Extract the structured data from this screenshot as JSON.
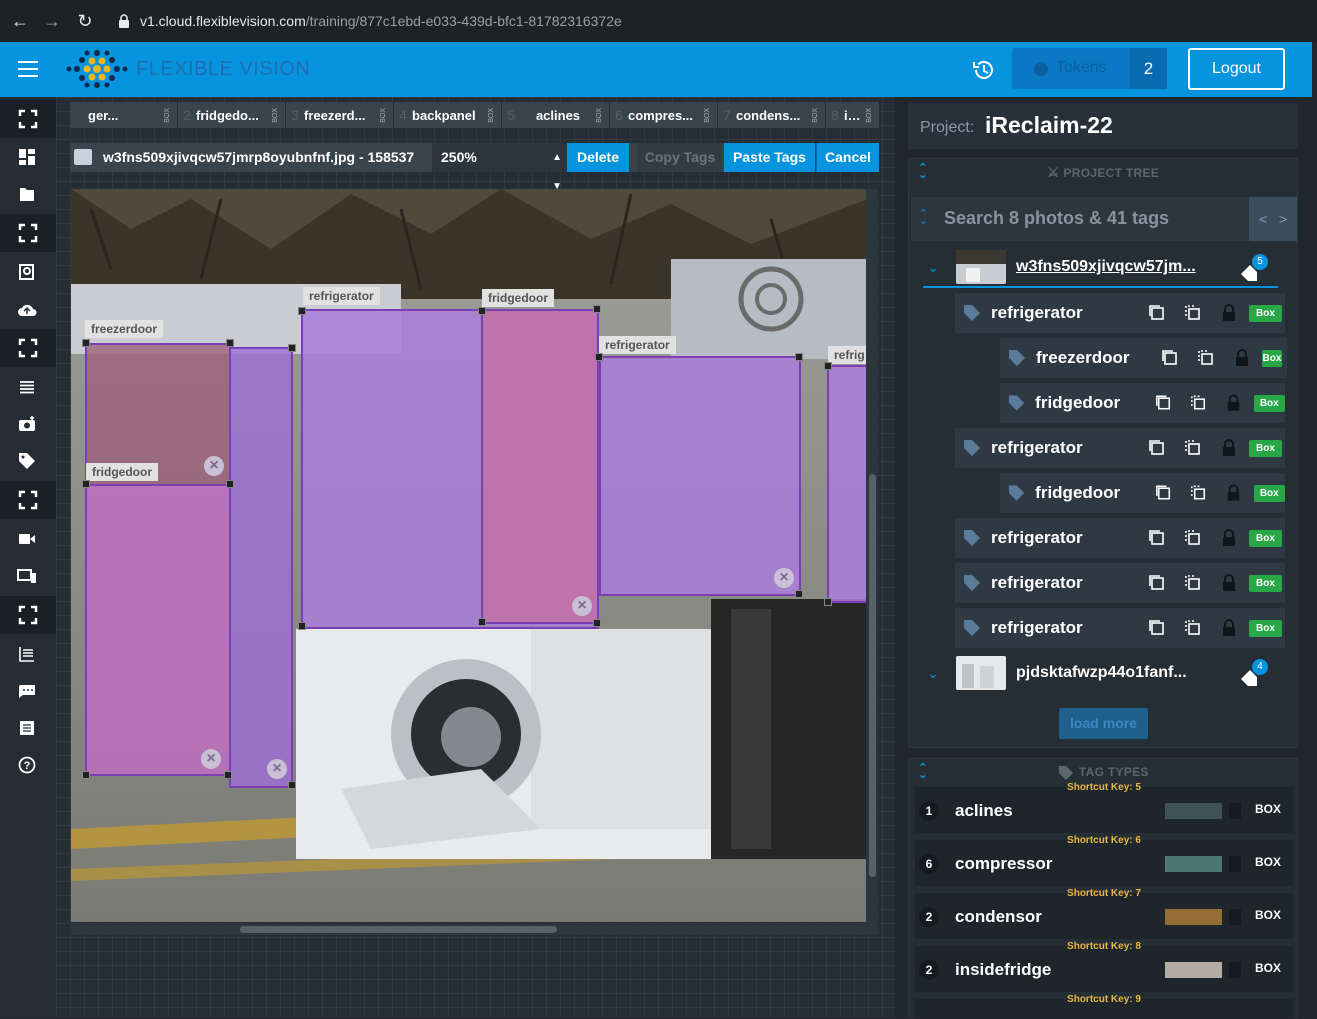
{
  "browser": {
    "url_host": "v1.cloud.flexiblevision.com",
    "url_path": "/training/877c1ebd-e033-439d-bfc1-81782316372e"
  },
  "header": {
    "logo_text": "FLEXIBLE VISION",
    "tokens_label": "Tokens",
    "tokens_count": "2",
    "logout_label": "Logout"
  },
  "tagbar": [
    {
      "num": "",
      "label": "ger...",
      "type": "BOX"
    },
    {
      "num": "2",
      "label": "fridgedo...",
      "type": "BOX"
    },
    {
      "num": "3",
      "label": "freezerd...",
      "type": "BOX"
    },
    {
      "num": "4",
      "label": "backpanel",
      "type": "BOX"
    },
    {
      "num": "5",
      "label": "aclines",
      "type": "BOX"
    },
    {
      "num": "6",
      "label": "compres...",
      "type": "BOX"
    },
    {
      "num": "7",
      "label": "condens...",
      "type": "BOX"
    },
    {
      "num": "8",
      "label": "insidefri...",
      "type": "BOX"
    }
  ],
  "toolbar": {
    "filename": "w3fns509xjivqcw57jmrp8oyubnfnf.jpg - 158537",
    "zoom": "250%",
    "delete": "Delete",
    "copy_tags": "Copy Tags",
    "paste_tags": "Paste Tags",
    "cancel": "Cancel"
  },
  "annotations": [
    {
      "label": "freezerdoor"
    },
    {
      "label": "fridgedoor"
    },
    {
      "label": "refrigerator"
    },
    {
      "label": "fridgedoor"
    },
    {
      "label": "refrigerator"
    },
    {
      "label": "refrig"
    }
  ],
  "project": {
    "key": "Project:",
    "name": "iReclaim-22"
  },
  "project_tree": {
    "title": "PROJECT TREE",
    "search_placeholder": "Search 8 photos & 41 tags",
    "prev": "<",
    "next": ">",
    "photos": [
      {
        "name": "w3fns509xjivqcw57jm...",
        "tag_count": "5"
      },
      {
        "name": "pjdsktafwzp44o1fanf...",
        "tag_count": "4"
      }
    ],
    "tags": [
      {
        "label": "refrigerator",
        "type": "Box"
      },
      {
        "label": "freezerdoor",
        "type": "Box"
      },
      {
        "label": "fridgedoor",
        "type": "Box"
      },
      {
        "label": "refrigerator",
        "type": "Box"
      },
      {
        "label": "fridgedoor",
        "type": "Box"
      },
      {
        "label": "refrigerator",
        "type": "Box"
      },
      {
        "label": "refrigerator",
        "type": "Box"
      },
      {
        "label": "refrigerator",
        "type": "Box"
      }
    ],
    "load_more": "load more"
  },
  "tag_types": {
    "title": "TAG TYPES",
    "items": [
      {
        "shortcut": "Shortcut Key: 5",
        "count": "1",
        "name": "aclines",
        "color": "#3f5256",
        "type": "BOX"
      },
      {
        "shortcut": "Shortcut Key: 6",
        "count": "6",
        "name": "compressor",
        "color": "#4d7771",
        "type": "BOX"
      },
      {
        "shortcut": "Shortcut Key: 7",
        "count": "2",
        "name": "condensor",
        "color": "#966d35",
        "type": "BOX"
      },
      {
        "shortcut": "Shortcut Key: 8",
        "count": "2",
        "name": "insidefridge",
        "color": "#b3ada6",
        "type": "BOX"
      }
    ],
    "next_shortcut": "Shortcut Key: 9"
  }
}
